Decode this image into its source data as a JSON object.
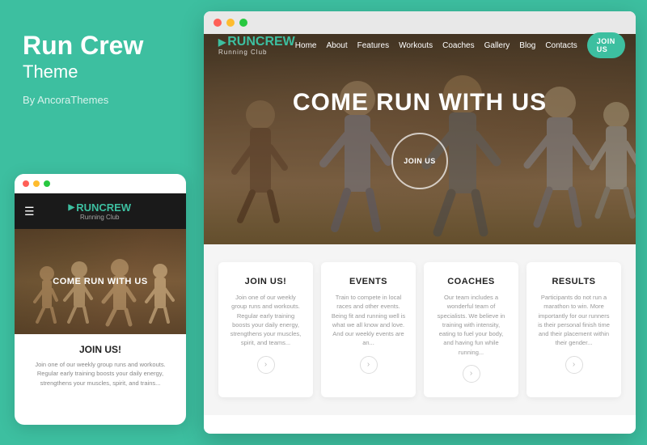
{
  "left": {
    "title": "Run Crew",
    "subtitle": "Theme",
    "by": "By AncoraThemes"
  },
  "mobile": {
    "logo": "RUNCREW",
    "logo_sub": "Running Club",
    "hero_text": "COME RUN WITH US",
    "join_title": "JOIN US!",
    "join_text": "Join one of our weekly group runs and workouts. Regular early training boosts your daily energy, strengthens your muscles, spirit, and trains..."
  },
  "browser": {
    "dots": [
      "red",
      "yellow",
      "green"
    ]
  },
  "nav": {
    "logo": "RUNCREW",
    "logo_sub": "Running Club",
    "links": [
      "Home",
      "About",
      "Features",
      "Workouts",
      "Coaches",
      "Gallery",
      "Blog",
      "Contacts"
    ],
    "cta": "JOIN US"
  },
  "hero": {
    "title": "COME RUN WITH US",
    "join_label": "JOIN US"
  },
  "cards": [
    {
      "title": "JOIN US!",
      "text": "Join one of our weekly group runs and workouts. Regular early training boosts your daily energy, strengthens your muscles, spirit, and teams..."
    },
    {
      "title": "EVENTS",
      "text": "Train to compete in local races and other events. Being fit and running well is what we all know and love. And our weekly events are an..."
    },
    {
      "title": "COACHES",
      "text": "Our team includes a wonderful team of specialists. We believe in training with intensity, eating to fuel your body, and having fun while running..."
    },
    {
      "title": "RESULTS",
      "text": "Participants do not run a marathon to win. More importantly for our runners is their personal finish time and their placement within their gender..."
    }
  ]
}
